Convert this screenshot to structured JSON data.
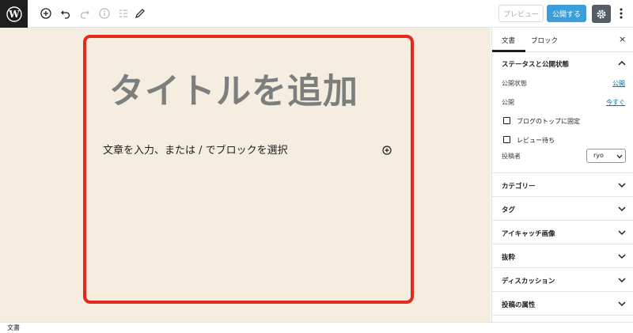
{
  "toolbar": {
    "logo_icon": "wordpress-logo-icon",
    "tools": [
      "add-block-icon",
      "undo-icon",
      "redo-icon",
      "info-icon",
      "list-view-icon",
      "edit-tools-icon"
    ],
    "preview_label": "プレビュー",
    "publish_label": "公開する",
    "settings_icon": "gear-icon",
    "more_icon": "more-vertical-icon",
    "publish_color": "#3a9edb"
  },
  "editor": {
    "title_placeholder": "タイトルを追加",
    "body_placeholder": "文章を入力、または / でブロックを選択",
    "highlight_color": "#e3281d",
    "canvas_color": "#f5ede0"
  },
  "sidebar": {
    "tabs": [
      "文書",
      "ブロック"
    ],
    "active_tab": "文書",
    "close_label": "×",
    "status_panel": {
      "title": "ステータスと公開状態",
      "visibility_label": "公開状態",
      "visibility_value": "公開",
      "publish_label": "公開",
      "publish_value": "今すぐ",
      "sticky_label": "ブログのトップに固定",
      "pending_label": "レビュー待ち",
      "author_label": "投稿者",
      "author_value": "ryo"
    },
    "panels": [
      "カテゴリー",
      "タグ",
      "アイキャッチ画像",
      "抜粋",
      "ディスカッション",
      "投稿の属性"
    ]
  },
  "footer": {
    "breadcrumb": "文書"
  }
}
